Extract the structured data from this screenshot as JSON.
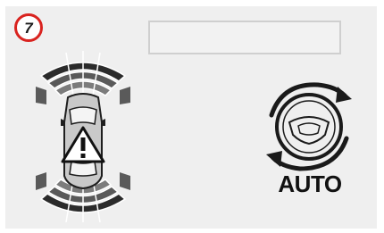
{
  "step": {
    "number": "7",
    "accent_color": "#d9231f"
  },
  "display": {
    "message_text": ""
  },
  "icons": {
    "parking_sensor": "car-parking-sensor-icon",
    "warning": "warning-triangle-icon",
    "steering": "steering-wheel-auto-icon"
  },
  "mode_label": "AUTO"
}
